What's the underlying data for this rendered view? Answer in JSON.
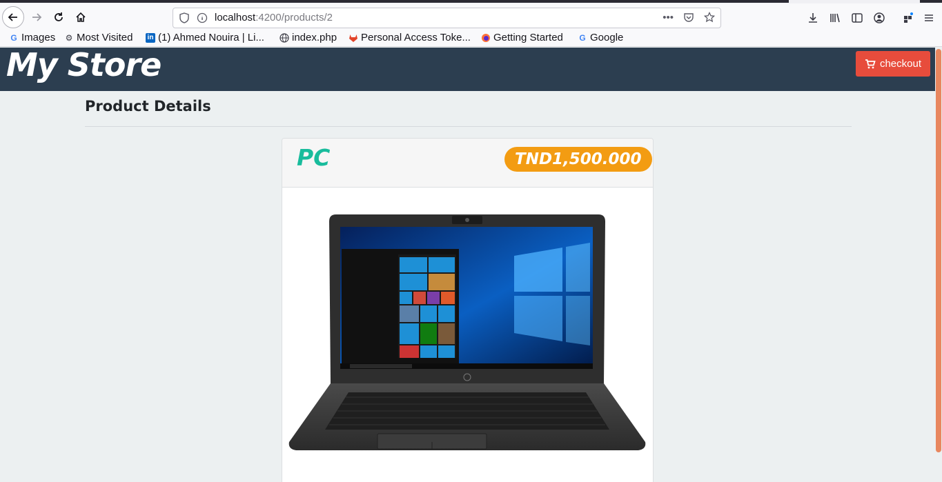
{
  "browser": {
    "url_host": "localhost",
    "url_path": ":4200/products/2",
    "url_actions": "•••",
    "bookmarks": [
      {
        "label": "Images",
        "icon": "google-icon"
      },
      {
        "label": "Most Visited",
        "icon": "gear-icon"
      },
      {
        "label": "(1) Ahmed Nouira | Li...",
        "icon": "linkedin-icon"
      },
      {
        "label": "index.php",
        "icon": "globe-icon"
      },
      {
        "label": "Personal Access Toke...",
        "icon": "gitlab-icon"
      },
      {
        "label": "Getting Started",
        "icon": "firefox-icon"
      },
      {
        "label": "Google",
        "icon": "google-icon"
      }
    ]
  },
  "navbar": {
    "brand": "My Store",
    "checkout_label": "checkout"
  },
  "main": {
    "section_title": "Product Details",
    "product": {
      "name": "PC",
      "price": "TND1,500.000",
      "image_icon": "laptop-image"
    }
  },
  "colors": {
    "navbar": "#2c3e50",
    "checkout": "#e74c3c",
    "product_name": "#18bc9c",
    "price_badge": "#f39c12",
    "background": "#ecf0f1"
  }
}
